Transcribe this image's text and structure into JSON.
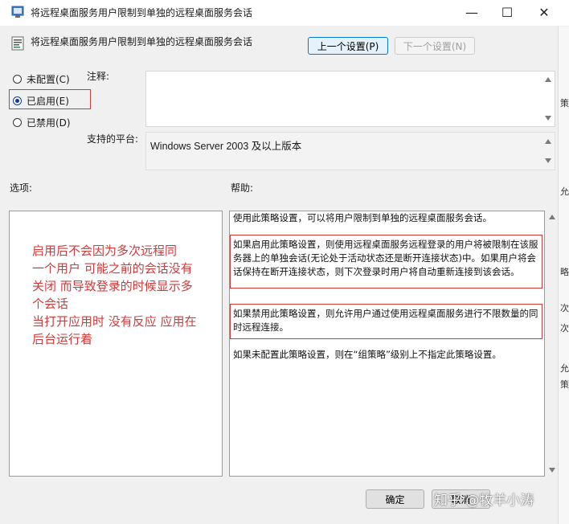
{
  "window": {
    "title": "将远程桌面服务用户限制到单独的远程桌面服务会话",
    "minimize_glyph": "—",
    "maximize_glyph": "☐",
    "close_glyph": "✕"
  },
  "header": {
    "policy_name": "将远程桌面服务用户限制到单独的远程桌面服务会话",
    "prev_button": "上一个设置(P)",
    "next_button": "下一个设置(N)"
  },
  "options": {
    "not_configured": "未配置(C)",
    "enabled": "已启用(E)",
    "disabled": "已禁用(D)",
    "selected": "enabled"
  },
  "comment_label": "注释:",
  "comment_value": "",
  "platform_label": "支持的平台:",
  "platform_value": "Windows Server 2003 及以上版本",
  "options_label": "选项:",
  "help_label": "帮助:",
  "annotation": "启用后不会因为多次远程同\n一个用户 可能之前的会话没有\n关闭 而导致登录的时候显示多\n个会话\n当打开应用时 没有反应 应用在\n后台运行着",
  "help_paragraphs": [
    "使用此策略设置，可以将用户限制到单独的远程桌面服务会话。",
    "如果启用此策略设置，则使用远程桌面服务远程登录的用户将被限制在该服务器上的单独会话(无论处于活动状态还是断开连接状态)中。如果用户将会话保持在断开连接状态，则下次登录时用户将自动重新连接到该会话。",
    "如果禁用此策略设置，则允许用户通过使用远程桌面服务进行不限数量的同时远程连接。",
    "如果未配置此策略设置，则在“组策略”级别上不指定此策略设置。"
  ],
  "footer": {
    "ok_button": "确定",
    "cancel_button": "取消"
  },
  "watermark": "知乎 @牧羊小涛",
  "bg_chars": [
    "෗",
    "策",
    "略",
    "次",
    "允",
    "策",
    "次",
    "次",
    "允"
  ],
  "colors": {
    "accent": "#0078d4",
    "annotation": "#d23a3a",
    "radio_checked": "#0b3d91"
  }
}
